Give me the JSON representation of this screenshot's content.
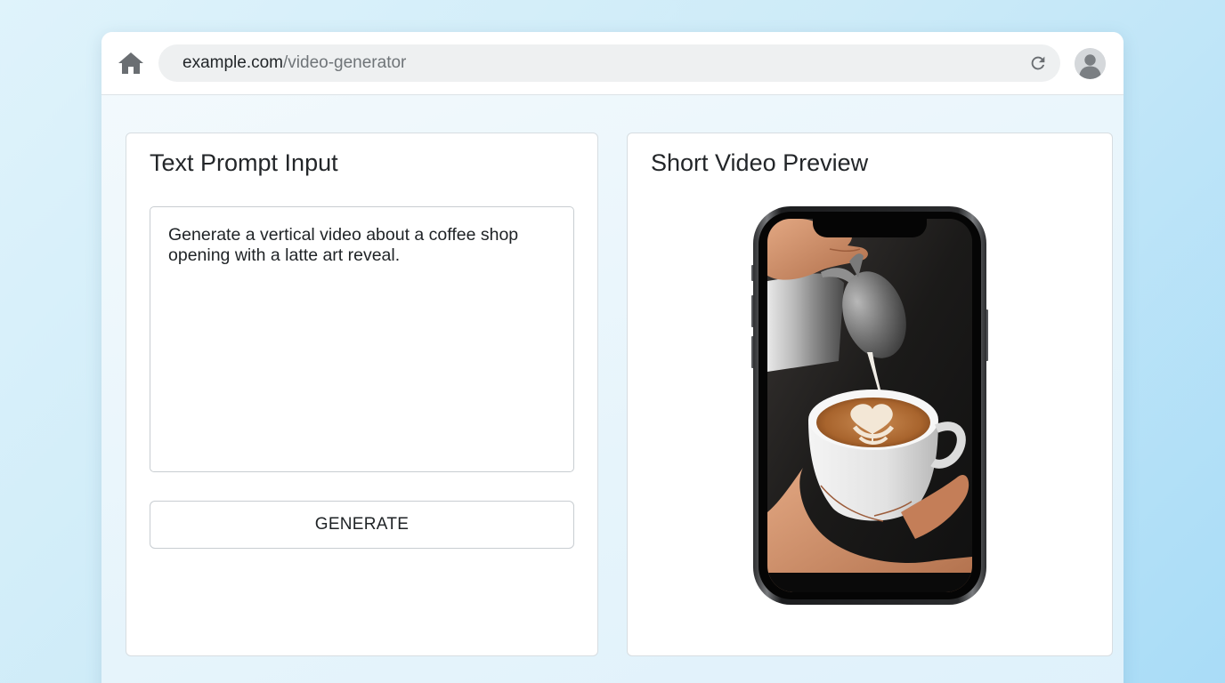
{
  "browser": {
    "url_domain": "example.com",
    "url_path": "/video-generator",
    "icons": {
      "home": "home-icon",
      "reload": "reload-icon",
      "account": "user-avatar-icon"
    }
  },
  "prompt_panel": {
    "title": "Text Prompt Input",
    "prompt_text": "Generate a vertical video about a coffee shop opening with a latte art reveal.",
    "button_label": "GENERATE"
  },
  "preview_panel": {
    "title": "Short Video Preview"
  },
  "colors": {
    "background": "#cdebf8",
    "panel": "#ffffff",
    "border": "#c8cdd1",
    "text": "#232629"
  }
}
